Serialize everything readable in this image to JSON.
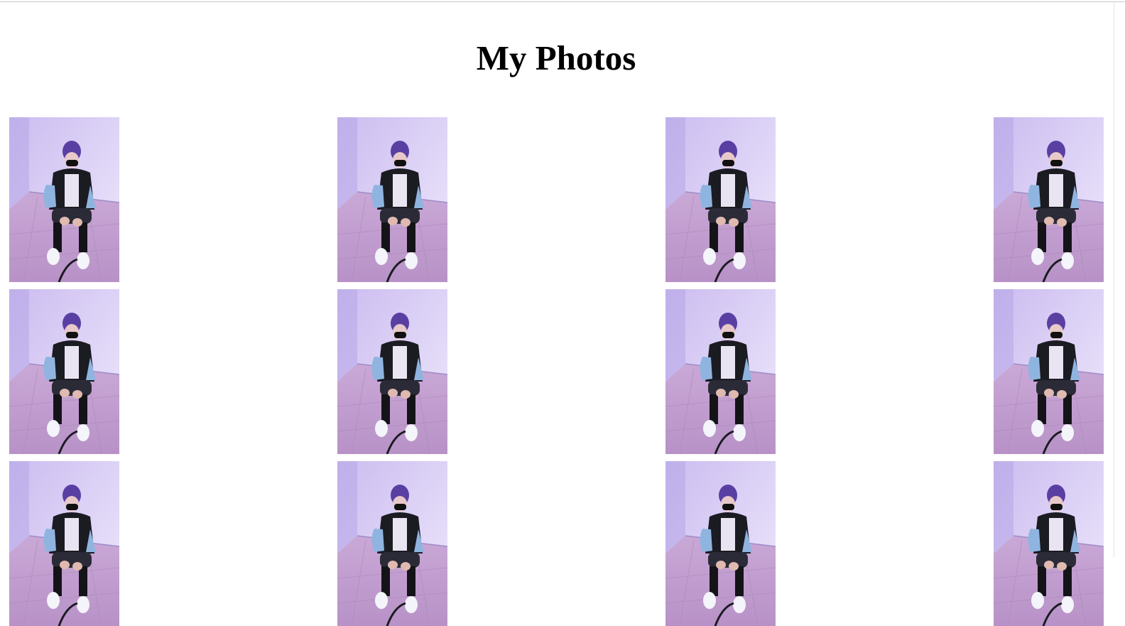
{
  "page": {
    "title": "My Photos"
  },
  "gallery": {
    "columns": 4,
    "rows_visible": 3,
    "photos": [
      {
        "subject": "person-sitting-purple-hair"
      },
      {
        "subject": "person-sitting-purple-hair"
      },
      {
        "subject": "person-sitting-purple-hair"
      },
      {
        "subject": "person-sitting-purple-hair"
      },
      {
        "subject": "person-sitting-purple-hair"
      },
      {
        "subject": "person-sitting-purple-hair"
      },
      {
        "subject": "person-sitting-purple-hair"
      },
      {
        "subject": "person-sitting-purple-hair"
      },
      {
        "subject": "person-sitting-purple-hair"
      },
      {
        "subject": "person-sitting-purple-hair"
      },
      {
        "subject": "person-sitting-purple-hair"
      },
      {
        "subject": "person-sitting-purple-hair"
      }
    ]
  },
  "colors": {
    "wall": "#d9ccf4",
    "floor": "#c9a8d6",
    "hair": "#5a3fa3",
    "jacket": "#1b1b22",
    "shirt": "#8fb4e0",
    "shoes": "#f4f4fb"
  }
}
